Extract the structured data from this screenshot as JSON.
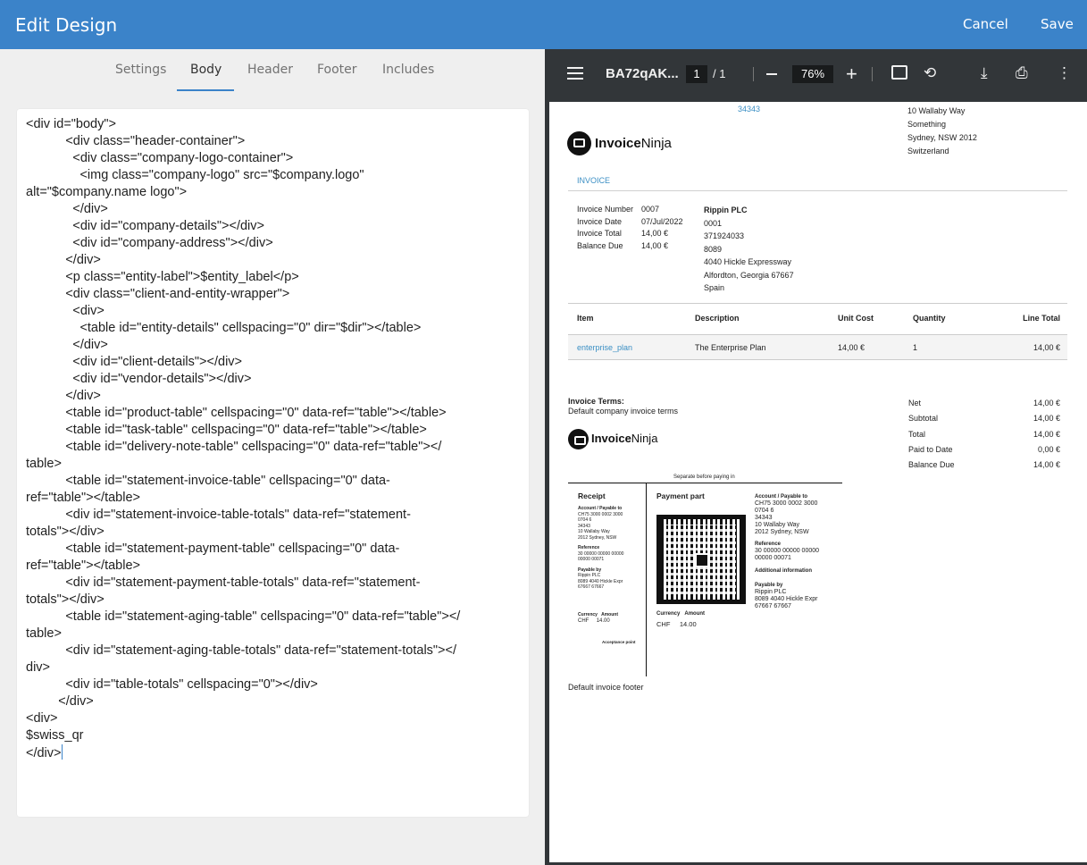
{
  "header": {
    "title": "Edit Design",
    "cancel": "Cancel",
    "save": "Save"
  },
  "tabs": [
    "Settings",
    "Body",
    "Header",
    "Footer",
    "Includes"
  ],
  "active_tab": "Body",
  "editor": {
    "code": "<div id=\"body\">\n           <div class=\"header-container\">\n             <div class=\"company-logo-container\">\n               <img class=\"company-logo\" src=\"$company.logo\"\nalt=\"$company.name logo\">\n             </div>\n             <div id=\"company-details\"></div>\n             <div id=\"company-address\"></div>\n           </div>\n           <p class=\"entity-label\">$entity_label</p>\n           <div class=\"client-and-entity-wrapper\">\n             <div>\n               <table id=\"entity-details\" cellspacing=\"0\" dir=\"$dir\"></table>\n             </div>\n             <div id=\"client-details\"></div>\n             <div id=\"vendor-details\"></div>\n           </div>\n           <table id=\"product-table\" cellspacing=\"0\" data-ref=\"table\"></table>\n           <table id=\"task-table\" cellspacing=\"0\" data-ref=\"table\"></table>\n           <table id=\"delivery-note-table\" cellspacing=\"0\" data-ref=\"table\"></\ntable>\n           <table id=\"statement-invoice-table\" cellspacing=\"0\" data-\nref=\"table\"></table>\n           <div id=\"statement-invoice-table-totals\" data-ref=\"statement-\ntotals\"></div>\n           <table id=\"statement-payment-table\" cellspacing=\"0\" data-\nref=\"table\"></table>\n           <div id=\"statement-payment-table-totals\" data-ref=\"statement-\ntotals\"></div>\n           <table id=\"statement-aging-table\" cellspacing=\"0\" data-ref=\"table\"></\ntable>\n           <div id=\"statement-aging-table-totals\" data-ref=\"statement-totals\"></\ndiv>\n           <div id=\"table-totals\" cellspacing=\"0\"></div>\n         </div>\n<div>\n$swiss_qr\n</div>"
  },
  "pdf_toolbar": {
    "filename": "BA72qAK...",
    "page_current": "1",
    "page_total": "/  1",
    "zoom": "76%"
  },
  "invoice": {
    "top_number": "34343",
    "company_address": [
      "10 Wallaby Way",
      "Something",
      "Sydney, NSW 2012",
      "Switzerland"
    ],
    "logo_bold": "Invoice",
    "logo_light": "Ninja",
    "entity_label": "INVOICE",
    "details": [
      {
        "label": "Invoice Number",
        "value": "0007"
      },
      {
        "label": "Invoice Date",
        "value": "07/Jul/2022"
      },
      {
        "label": "Invoice Total",
        "value": "14,00 €"
      },
      {
        "label": "Balance Due",
        "value": "14,00 €"
      }
    ],
    "client": [
      "Rippin PLC",
      "0001",
      "371924033",
      "8089",
      "4040 Hickle Expressway",
      "Alfordton, Georgia 67667",
      "Spain"
    ],
    "table_headers": [
      "Item",
      "Description",
      "Unit Cost",
      "Quantity",
      "Line Total"
    ],
    "table_row": [
      "enterprise_plan",
      "The Enterprise Plan",
      "14,00 €",
      "1",
      "14,00 €"
    ],
    "terms_label": "Invoice Terms:",
    "terms_text": "Default company invoice terms",
    "totals": [
      {
        "label": "Net",
        "value": "14,00 €"
      },
      {
        "label": "Subtotal",
        "value": "14,00 €"
      },
      {
        "label": "Total",
        "value": "14,00 €"
      },
      {
        "label": "Paid to Date",
        "value": "0,00 €"
      },
      {
        "label": "Balance Due",
        "value": "14,00 €"
      }
    ],
    "separate_text": "Separate before paying in",
    "receipt": {
      "title": "Receipt",
      "account_label": "Account / Payable to",
      "account_lines": [
        "CH75 3000 0002 3000",
        "0704 6",
        "34343",
        "10 Wallaby Way",
        "2012 Sydney, NSW"
      ],
      "reference_label": "Reference",
      "reference_lines": [
        "30 00000 00000 00000",
        "00000 00071"
      ],
      "payable_by_label": "Payable by",
      "payable_by_lines": [
        "Rippin PLC",
        "8089 4040 Hickle Expr",
        "67667 67667"
      ],
      "currency_label": "Currency",
      "amount_label": "Amount",
      "currency": "CHF",
      "amount": "14.00",
      "acceptance": "Acceptance point"
    },
    "payment_part": {
      "title": "Payment part",
      "currency_label": "Currency",
      "amount_label": "Amount",
      "currency": "CHF",
      "amount": "14.00",
      "account_label": "Account / Payable to",
      "account_lines": [
        "CH75 3000 0002 3000",
        "0704 6",
        "34343",
        "10 Wallaby Way",
        "2012 Sydney, NSW"
      ],
      "reference_label": "Reference",
      "reference_lines": [
        "30 00000 00000 00000",
        "00000 00071"
      ],
      "additional_label": "Additional information",
      "payable_by_label": "Payable by",
      "payable_by_lines": [
        "Rippin PLC",
        "8089 4040 Hickle Expr",
        "67667 67667"
      ]
    },
    "footer": "Default invoice footer"
  }
}
